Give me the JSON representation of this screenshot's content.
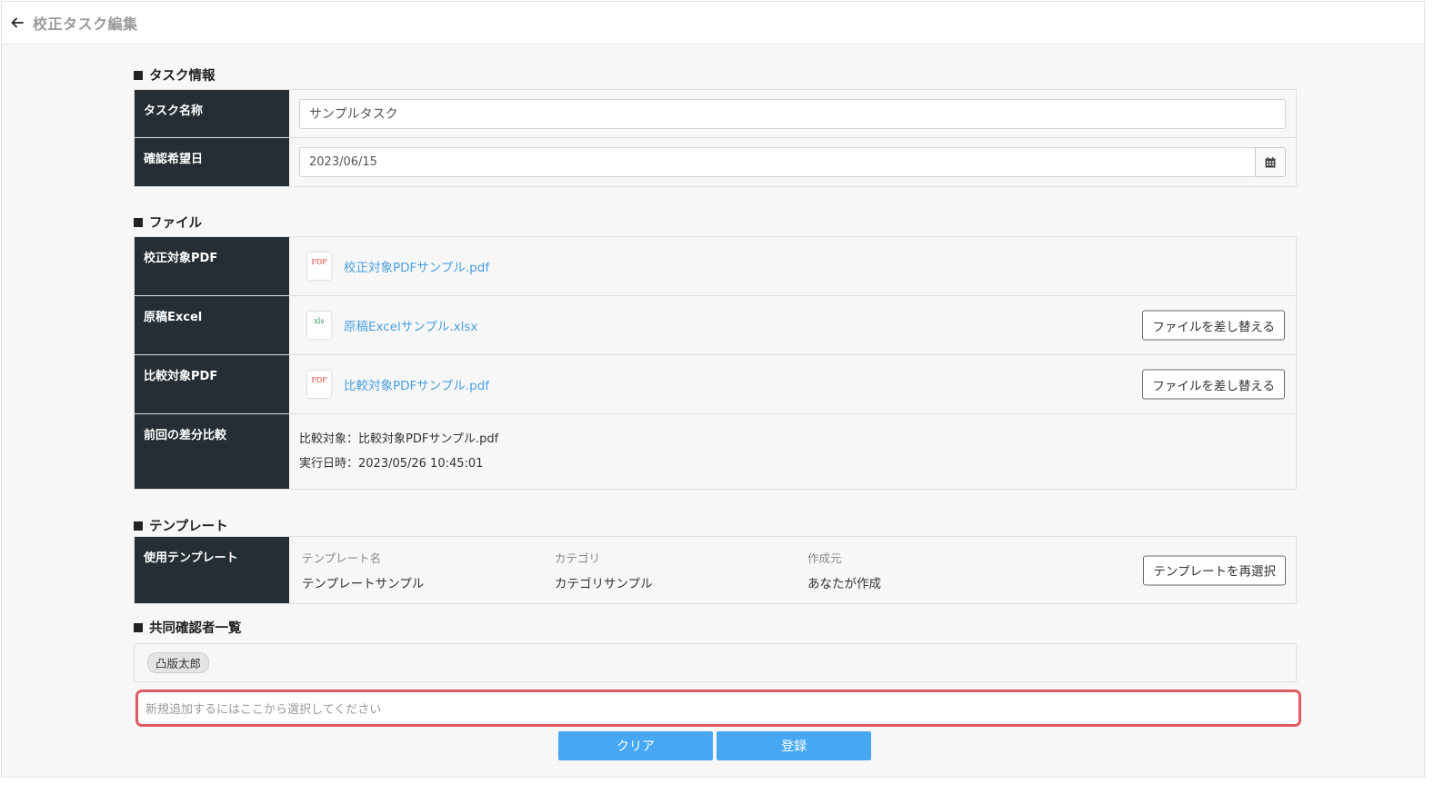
{
  "header": {
    "title": "校正タスク編集"
  },
  "sections": {
    "task_info": "タスク情報",
    "files": "ファイル",
    "template": "テンプレート",
    "coreviewers": "共同確認者一覧"
  },
  "task": {
    "name_label": "タスク名称",
    "name_value": "サンプルタスク",
    "date_label": "確認希望日",
    "date_value": "2023/06/15"
  },
  "files": {
    "target_pdf": {
      "label": "校正対象PDF",
      "icon_text": "PDF",
      "link": "校正対象PDFサンプル.pdf"
    },
    "source_excel": {
      "label": "原稿Excel",
      "icon_text": "xls",
      "link": "原稿Excelサンプル.xlsx",
      "replace": "ファイルを差し替える"
    },
    "compare_pdf": {
      "label": "比較対象PDF",
      "icon_text": "PDF",
      "link": "比較対象PDFサンプル.pdf",
      "replace": "ファイルを差し替える"
    },
    "prev_diff": {
      "label": "前回の差分比較",
      "line1": "比較対象：比較対象PDFサンプル.pdf",
      "line2": "実行日時：2023/05/26 10:45:01"
    }
  },
  "template": {
    "label": "使用テンプレート",
    "name_head": "テンプレート名",
    "name_value": "テンプレートサンプル",
    "category_head": "カテゴリ",
    "category_value": "カテゴリサンプル",
    "creator_head": "作成元",
    "creator_value": "あなたが作成",
    "reselect": "テンプレートを再選択"
  },
  "coreviewers": {
    "chips": [
      "凸版太郎"
    ],
    "add_placeholder": "新規追加するにはここから選択してください"
  },
  "actions": {
    "clear": "クリア",
    "submit": "登録"
  },
  "colors": {
    "label_bg": "#252e34",
    "link": "#4a9fe0",
    "primary": "#46a7f5",
    "highlight": "#e05a63"
  }
}
